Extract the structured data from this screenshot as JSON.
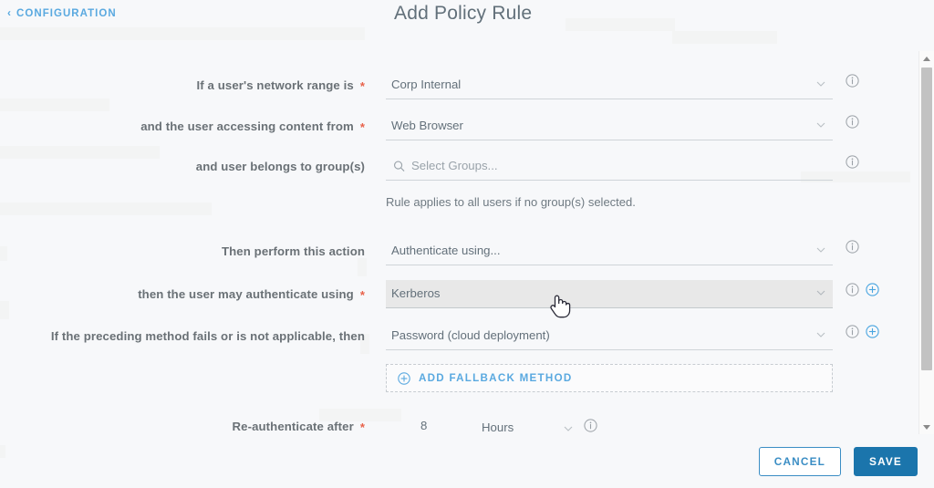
{
  "header": {
    "back_link": "CONFIGURATION",
    "back_chevron": "chevron-left-icon",
    "title": "Add Policy Rule"
  },
  "form": {
    "rows": [
      {
        "label": "If a user's network range is",
        "required": true,
        "value": "Corp Internal",
        "control": "dropdown",
        "info": true,
        "add": false
      },
      {
        "label": "and the user accessing content from",
        "required": true,
        "value": "Web Browser",
        "control": "dropdown",
        "info": true,
        "add": false
      },
      {
        "label": "and user belongs to group(s)",
        "required": false,
        "value": "",
        "placeholder": "Select Groups...",
        "control": "search",
        "info": true,
        "add": false
      },
      {
        "label": "Then perform this action",
        "required": false,
        "value": "Authenticate using...",
        "control": "dropdown",
        "info": true,
        "add": false
      },
      {
        "label": "then the user may authenticate using",
        "required": true,
        "value": "Kerberos",
        "control": "dropdown",
        "info": true,
        "add": true,
        "hovered": true
      },
      {
        "label": "If the preceding method fails or is not applicable, then",
        "required": false,
        "value": "Password (cloud deployment)",
        "control": "dropdown",
        "info": true,
        "add": true
      }
    ],
    "group_helper_text": "Rule applies to all users if no group(s) selected.",
    "add_fallback_label": "ADD FALLBACK METHOD",
    "add_fallback_icon": "plus-circle-icon",
    "reauth": {
      "label": "Re-authenticate after",
      "required": true,
      "amount": "8",
      "unit": "Hours",
      "info": true
    }
  },
  "footer": {
    "cancel_label": "CANCEL",
    "save_label": "SAVE"
  },
  "colors": {
    "accent_link": "#5aa9e0",
    "save_bg": "#1b75ac",
    "cancel_border": "#3a8dc4",
    "required_asterisk": "#e8624a",
    "page_bg": "#f7f8fa",
    "field_underline": "#cfd4d8",
    "hover_bg": "#e8e8e8"
  }
}
